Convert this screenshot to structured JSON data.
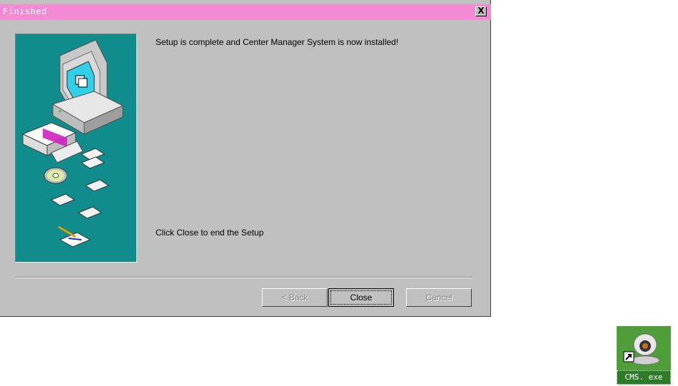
{
  "window": {
    "title": "Finished",
    "close_glyph": "X"
  },
  "content": {
    "message_complete": "Setup is complete and Center Manager System is now installed!",
    "message_close": "Click Close to end the Setup"
  },
  "buttons": {
    "back_label": "< Back",
    "close_label": "Close",
    "cancel_label": "Cancel"
  },
  "desktop": {
    "icon_label": "CMS. exe",
    "icon_name": "webcam-shortcut-icon"
  },
  "colors": {
    "titlebar": "#f48ad4",
    "art_background": "#108c8c",
    "dialog_face": "#c0c0c0"
  }
}
